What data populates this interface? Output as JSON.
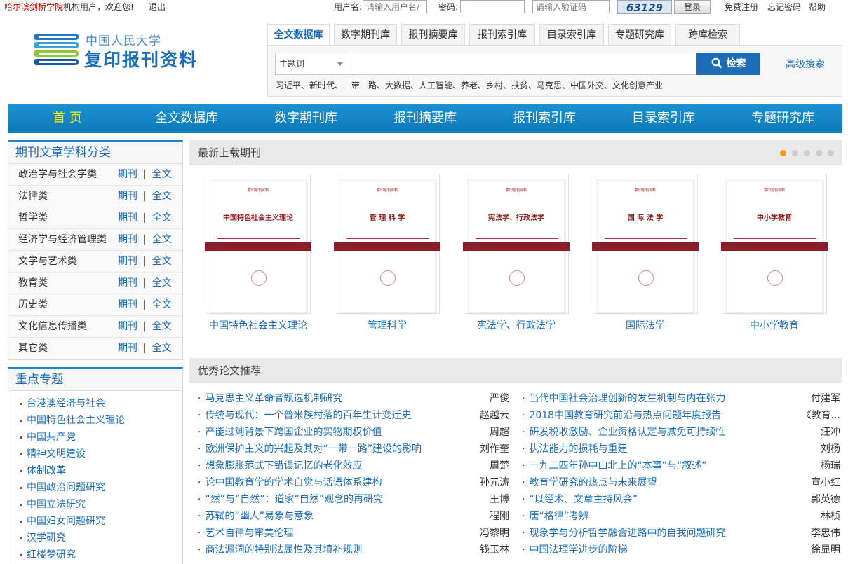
{
  "topbar": {
    "org_name": "哈尔滨剑桥学院",
    "welcome_text": "机构用户，欢迎您!",
    "logout": "退出",
    "username_label": "用户名:",
    "username_placeholder": "请输入用户名/",
    "password_label": "密码:",
    "captcha_placeholder": "请输入验证码",
    "captcha_code": "63129",
    "login_button": "登录",
    "register": "免费注册",
    "forgot_password": "忘记密码",
    "help": "帮助"
  },
  "logo": {
    "university": "中国人民大学",
    "product": "复印报刊资料"
  },
  "search": {
    "tabs": [
      "全文数据库",
      "数字期刊库",
      "报刊摘要库",
      "报刊索引库",
      "目录索引库",
      "专题研究库",
      "跨库检索"
    ],
    "field_select": "主题词",
    "input_value": "",
    "search_button": "检索",
    "advanced": "高级搜索",
    "hot_words": "习近平、新时代、一带一路、大数据、人工智能、养老、乡村、扶贫、马克思、中国外交、文化创意产业"
  },
  "main_nav": [
    "首 页",
    "全文数据库",
    "数字期刊库",
    "报刊摘要库",
    "报刊索引库",
    "目录索引库",
    "专题研究库"
  ],
  "categories": {
    "title": "期刊文章学科分类",
    "journal_label": "期刊",
    "fulltext_label": "全文",
    "items": [
      "政治学与社会学类",
      "法律类",
      "哲学类",
      "经济学与经济管理类",
      "文学与艺术类",
      "教育类",
      "历史类",
      "文化信息传播类",
      "其它类"
    ]
  },
  "topics": {
    "title": "重点专题",
    "items": [
      "台港澳经济与社会",
      "中国特色社会主义理论",
      "中国共产党",
      "精神文明建设",
      "体制改革",
      "中国政治问题研究",
      "中国立法研究",
      "中国妇女问题研究",
      "汉学研究",
      "红楼梦研究"
    ]
  },
  "journals": {
    "title": "最新上载期刊",
    "slide_count": 5,
    "active_slide": 1,
    "items": [
      {
        "name": "中国特色社会主义理论",
        "cover_title": "中国特色社会主义理论"
      },
      {
        "name": "管理科学",
        "cover_title": "管 理 科 学"
      },
      {
        "name": "宪法学、行政法学",
        "cover_title": "宪法学、行政法学"
      },
      {
        "name": "国际法学",
        "cover_title": "国 际 法 学"
      },
      {
        "name": "中小学教育",
        "cover_title": "中小学教育"
      }
    ],
    "cover_header": "复印报刊资料"
  },
  "papers": {
    "title": "优秀论文推荐",
    "left": [
      {
        "title": "马克思主义革命者甄选机制研究",
        "author": "严俊"
      },
      {
        "title": "传统与现代：一个普米族村落的百年生计变迁史",
        "author": "赵越云"
      },
      {
        "title": "产能过剩背景下跨国企业的实物期权价值",
        "author": "周超"
      },
      {
        "title": "欧洲保护主义的兴起及其对“一带一路”建设的影响",
        "author": "刘作奎"
      },
      {
        "title": "想象膨胀范式下错误记忆的老化效应",
        "author": "周楚"
      },
      {
        "title": "论中国教育学的学术自觉与话语体系建构",
        "author": "孙元涛"
      },
      {
        "title": "“然”与“自然”：道家“自然”观念的再研究",
        "author": "王博"
      },
      {
        "title": "苏轼的“幽人”易象与意象",
        "author": "程刚"
      },
      {
        "title": "艺术自律与审美伦理",
        "author": "冯黎明"
      },
      {
        "title": "商法漏洞的特别法属性及其填补规则",
        "author": "钱玉林"
      }
    ],
    "right": [
      {
        "title": "当代中国社会治理创新的发生机制与内在张力",
        "author": "付建军"
      },
      {
        "title": "2018中国教育研究前沿与热点问题年度报告",
        "author": "《教育..."
      },
      {
        "title": "研发税收激励、企业资格认定与减免可持续性",
        "author": "汪冲"
      },
      {
        "title": "执法能力的损耗与重建",
        "author": "刘杨"
      },
      {
        "title": "一九二四年孙中山北上的“本事”与“叙述”",
        "author": "杨瑞"
      },
      {
        "title": "教育学研究的热点与未来展望",
        "author": "宣小红"
      },
      {
        "title": "“以经术、文章主持风会”",
        "author": "郭英德"
      },
      {
        "title": "唐“格律”考辨",
        "author": "林桢"
      },
      {
        "title": "现象学与分析哲学融合进路中的自我问题研究",
        "author": "李忠伟"
      },
      {
        "title": "中国法理学进步的阶梯",
        "author": "徐显明"
      }
    ]
  },
  "colors": {
    "brand_blue": "#1c6db5",
    "nav_blue": "#1b92d4",
    "home_yellow": "#ffea00",
    "slider_active": "#f29c1f"
  }
}
